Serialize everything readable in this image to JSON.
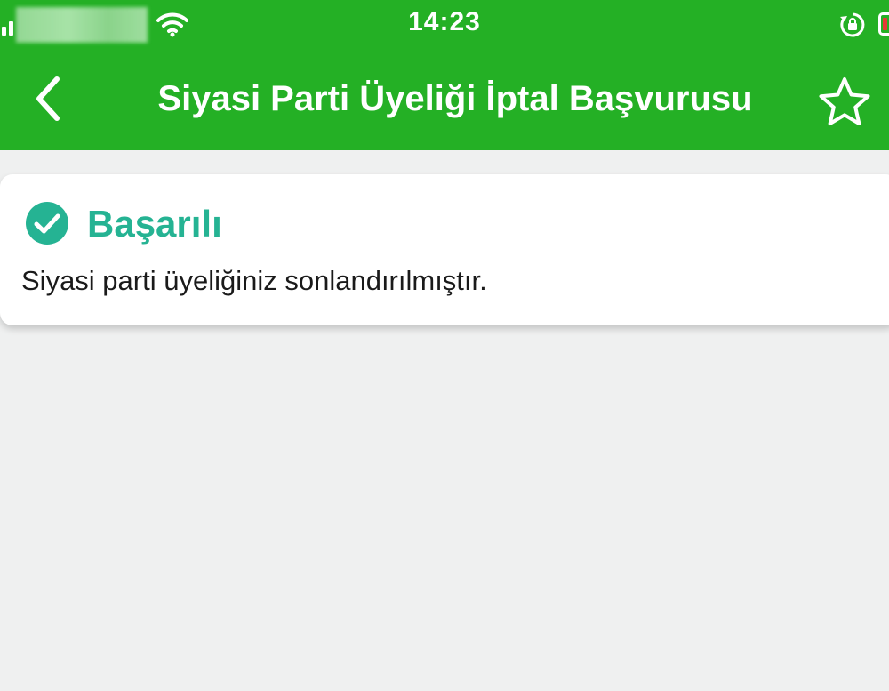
{
  "status_bar": {
    "time": "14:23",
    "icons": [
      "signal-icon",
      "wifi-icon",
      "rotation-lock-icon",
      "battery-icon"
    ]
  },
  "nav_bar": {
    "title": "Siyasi Parti Üyeliği İptal Başvurusu",
    "back_icon": "chevron-left-icon",
    "favorite_icon": "star-outline-icon"
  },
  "result": {
    "status_icon": "check-circle-icon",
    "title": "Başarılı",
    "message": "Siyasi parti üyeliğiniz sonlandırılmıştır."
  },
  "colors": {
    "header_green": "#24b025",
    "success_teal": "#25b393",
    "background": "#eff0f0",
    "card": "#ffffff",
    "battery_low": "#e53935"
  }
}
